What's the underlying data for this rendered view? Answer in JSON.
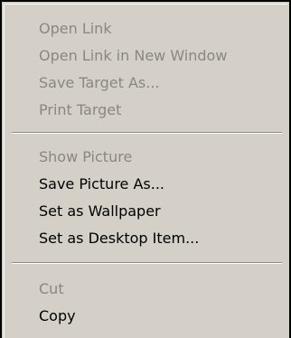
{
  "menu": {
    "items": [
      {
        "label": "Open Link",
        "disabled": true
      },
      {
        "label": "Open Link in New Window",
        "disabled": true
      },
      {
        "label": "Save Target As...",
        "disabled": true
      },
      {
        "label": "Print Target",
        "disabled": true
      },
      {
        "label": "Show Picture",
        "disabled": true
      },
      {
        "label": "Save Picture As...",
        "disabled": false
      },
      {
        "label": "Set as Wallpaper",
        "disabled": false
      },
      {
        "label": "Set as Desktop Item...",
        "disabled": false
      },
      {
        "label": "Cut",
        "disabled": true
      },
      {
        "label": "Copy",
        "disabled": false
      }
    ]
  },
  "colors": {
    "menu_background": "#d4d0c8",
    "enabled_text": "#000000",
    "disabled_text": "#8a8782"
  }
}
